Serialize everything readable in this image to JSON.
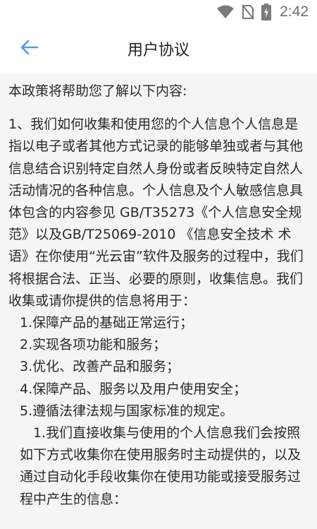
{
  "status_bar": {
    "time": "2:42",
    "icons": [
      "wifi-icon",
      "no-sim-icon",
      "battery-charging-icon"
    ]
  },
  "app_bar": {
    "back_icon": "arrow-left-icon",
    "accent_color": "#4a9df2",
    "title": "用户协议"
  },
  "content": {
    "intro": "本政策将帮助您了解以下内容:",
    "section1": "1、我们如何收集和使用您的个人信息个人信息是指以电子或者其他方式记录的能够单独或者与其他信息结合识别特定自然人身份或者反映特定自然人活动情况的各种信息。个人信息及个人敏感信息具体包含的内容参见 GB/T35273《个人信息安全规范》以及GB/T25069-2010 《信息安全技术 术语》在你使用“光云宙”软件及服务的过程中，我们将根据合法、正当、必要的原则，收集信息。我们收集或请你提供的信息将用于：",
    "list": [
      "1.保障产品的基础正常运行；",
      "2.实现各项功能和服务；",
      "3.优化、改善产品和服务；",
      "4.保障产品、服务以及用户使用安全；",
      "5.遵循法律法规与国家标准的规定。"
    ],
    "sub_section": "1.我们直接收集与使用的个人信息我们会按照如下方式收集你在使用服务时主动提供的，以及通过自动化手段收集你在使用功能或接受服务过程中产生的信息："
  }
}
